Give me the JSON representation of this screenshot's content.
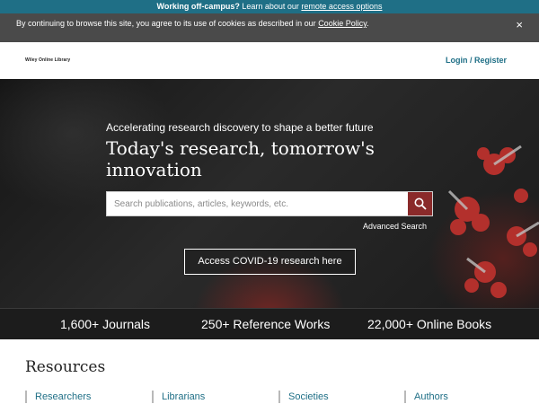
{
  "offcampus": {
    "bold": "Working off-campus?",
    "text": " Learn about our ",
    "link": "remote access options"
  },
  "cookie": {
    "message": "By continuing to browse this site, you agree to its use of cookies as described in our ",
    "link": "Cookie Policy",
    "end": ".",
    "close": "×"
  },
  "header": {
    "logo": "Wiley Online Library",
    "login": "Login / Register"
  },
  "hero": {
    "tagline": "Accelerating research discovery to shape a better future",
    "headline": "Today's research, tomorrow's innovation",
    "search_placeholder": "Search publications, articles, keywords, etc.",
    "advanced_search": "Advanced Search",
    "covid_button": "Access COVID-19 research here"
  },
  "stats": [
    "1,600+ Journals",
    "250+ Reference Works",
    "22,000+ Online Books"
  ],
  "resources": {
    "title": "Resources",
    "links": [
      "Researchers",
      "Librarians",
      "Societies",
      "Authors"
    ]
  },
  "colors": {
    "teal": "#1f6f86",
    "search_button": "#8a2a2a",
    "cookie_bar": "#4a4a4a"
  }
}
